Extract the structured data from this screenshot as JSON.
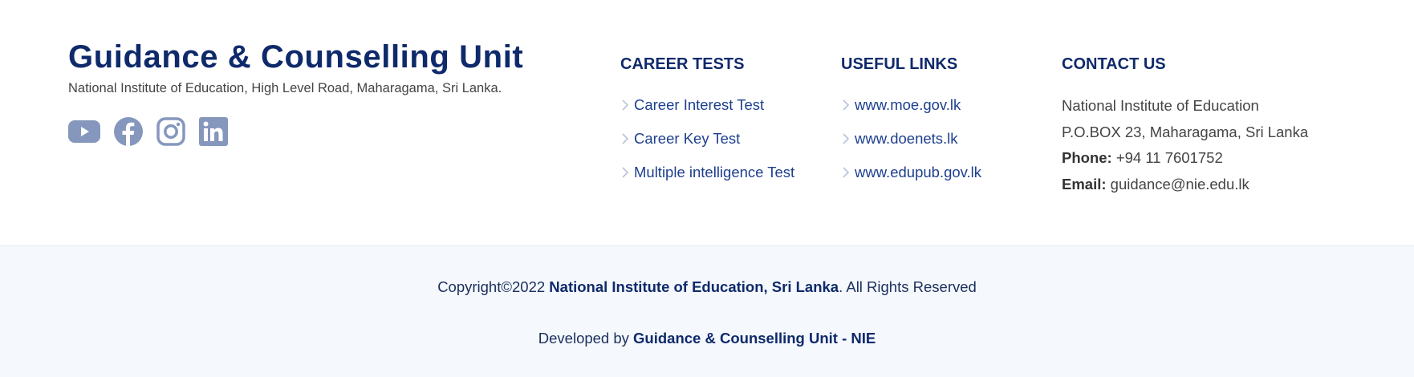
{
  "brand": {
    "title": "Guidance & Counselling Unit",
    "address": "National Institute of Education, High Level Road, Maharagama, Sri Lanka."
  },
  "socials": [
    {
      "name": "youtube-icon"
    },
    {
      "name": "facebook-icon"
    },
    {
      "name": "instagram-icon"
    },
    {
      "name": "linkedin-icon"
    }
  ],
  "career_tests": {
    "heading": "CAREER TESTS",
    "items": [
      {
        "label": "Career Interest Test"
      },
      {
        "label": "Career Key Test"
      },
      {
        "label": "Multiple intelligence Test"
      }
    ]
  },
  "useful_links": {
    "heading": "USEFUL LINKS",
    "items": [
      {
        "label": "www.moe.gov.lk"
      },
      {
        "label": "www.doenets.lk"
      },
      {
        "label": "www.edupub.gov.lk"
      }
    ]
  },
  "contact": {
    "heading": "CONTACT US",
    "org": "National Institute of Education",
    "address": "P.O.BOX 23, Maharagama, Sri Lanka",
    "phone_label": "Phone:",
    "phone": " +94 11 7601752",
    "email_label": "Email:",
    "email": " guidance@nie.edu.lk"
  },
  "copyright": {
    "prefix": "Copyright©2022 ",
    "org": "National Institute of Education, Sri Lanka",
    "suffix": ". All Rights Reserved"
  },
  "developed": {
    "prefix": "Developed by ",
    "org": "Guidance & Counselling Unit - NIE"
  },
  "colors": {
    "primary": "#0f2a6b",
    "link": "#1d3f8f",
    "icon": "#8597bd",
    "bottom_bg": "#f5f8fd"
  }
}
